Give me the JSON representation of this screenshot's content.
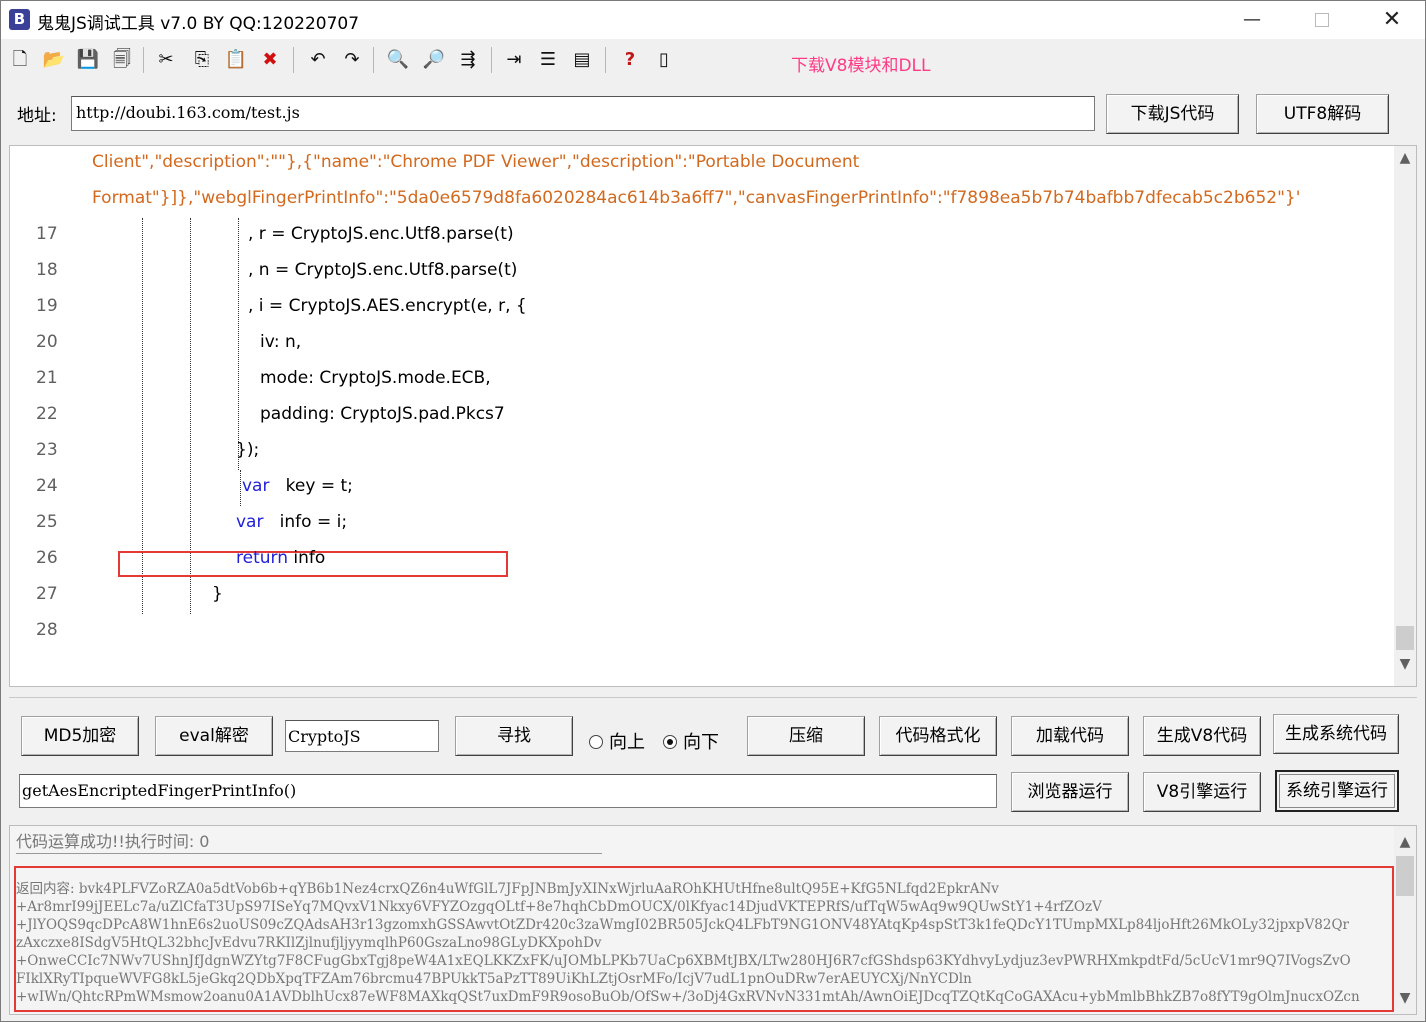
{
  "window": {
    "title": "鬼鬼JS调试工具 v7.0 BY QQ:120220707",
    "app_icon": "B",
    "minimize": "—",
    "close": "✕"
  },
  "toolbar": {
    "icons": [
      {
        "name": "new-file-icon",
        "glyph": "🗋"
      },
      {
        "name": "open-folder-icon",
        "glyph": "📂"
      },
      {
        "name": "save-icon",
        "glyph": "💾"
      },
      {
        "name": "save-all-icon",
        "glyph": "🗐"
      },
      {
        "name": "cut-icon",
        "glyph": "✂"
      },
      {
        "name": "copy-icon",
        "glyph": "⎘"
      },
      {
        "name": "paste-icon",
        "glyph": "📋"
      },
      {
        "name": "delete-icon",
        "glyph": "✖"
      },
      {
        "name": "undo-icon",
        "glyph": "↶"
      },
      {
        "name": "redo-icon",
        "glyph": "↷"
      },
      {
        "name": "find-icon",
        "glyph": "🔍"
      },
      {
        "name": "find-next-icon",
        "glyph": "🔎"
      },
      {
        "name": "replace-icon",
        "glyph": "⇶"
      },
      {
        "name": "indent-icon",
        "glyph": "⇥"
      },
      {
        "name": "numbered-list-icon",
        "glyph": "☰"
      },
      {
        "name": "window-icon",
        "glyph": "▤"
      },
      {
        "name": "help-icon",
        "glyph": "?"
      },
      {
        "name": "panel-icon",
        "glyph": "▯"
      }
    ],
    "download_link": "下载V8模块和DLL"
  },
  "address": {
    "label": "地址:",
    "value": "http://doubi.163.com/test.js",
    "download_button": "下载JS代码",
    "utf8_button": "UTF8解码"
  },
  "editor": {
    "lines": [
      {
        "num": "",
        "parts": [
          {
            "cls": "str",
            "text": "Client\",\"description\":\"\"},{\"name\":\"Chrome PDF Viewer\",\"description\":\"Portable Document"
          }
        ]
      },
      {
        "num": "",
        "parts": [
          {
            "cls": "str",
            "text": "Format\"}]},\"webglFingerPrintInfo\":\"5da0e6579d8fa6020284ac614b3a6ff7\",\"canvasFingerPrintInfo\":\"f7898ea5b7b74bafbb7dfecab5c2b652\"}'"
          }
        ]
      },
      {
        "num": "17",
        "parts": [
          {
            "cls": "txt",
            "text": ", r = CryptoJS.enc.Utf8.parse(t)"
          }
        ]
      },
      {
        "num": "18",
        "parts": [
          {
            "cls": "txt",
            "text": ", n = CryptoJS.enc.Utf8.parse(t)"
          }
        ]
      },
      {
        "num": "19",
        "parts": [
          {
            "cls": "txt",
            "text": ", i = CryptoJS.AES.encrypt(e, r, {"
          }
        ]
      },
      {
        "num": "20",
        "parts": [
          {
            "cls": "txt",
            "text": "iv: n,"
          }
        ]
      },
      {
        "num": "21",
        "parts": [
          {
            "cls": "txt",
            "text": "mode: CryptoJS.mode.ECB,"
          }
        ]
      },
      {
        "num": "22",
        "parts": [
          {
            "cls": "txt",
            "text": "padding: CryptoJS.pad.Pkcs7"
          }
        ]
      },
      {
        "num": "23",
        "parts": [
          {
            "cls": "txt",
            "text": "});"
          }
        ]
      },
      {
        "num": "24",
        "parts": [
          {
            "cls": "kw",
            "text": "var"
          },
          {
            "cls": "txt",
            "text": "   key = t;"
          }
        ]
      },
      {
        "num": "25",
        "parts": [
          {
            "cls": "kw",
            "text": "var"
          },
          {
            "cls": "txt",
            "text": "   info = i;"
          }
        ]
      },
      {
        "num": "26",
        "parts": [
          {
            "cls": "kw",
            "text": "return"
          },
          {
            "cls": "txt",
            "text": " info"
          }
        ]
      },
      {
        "num": "27",
        "parts": [
          {
            "cls": "txt",
            "text": "}"
          }
        ]
      },
      {
        "num": "28",
        "parts": []
      }
    ]
  },
  "controls": {
    "md5_button": "MD5加密",
    "eval_button": "eval解密",
    "search_value": "CryptoJS",
    "find_button": "寻找",
    "radio_up": "向上",
    "radio_down": "向下",
    "radio_selected": "down",
    "compress_button": "压缩",
    "format_button": "代码格式化",
    "load_button": "加载代码",
    "gen_v8_button": "生成V8代码",
    "gen_system_button": "生成系统代码",
    "function_value": "getAesEncriptedFingerPrintInfo()",
    "browser_run_button": "浏览器运行",
    "v8_run_button": "V8引擎运行",
    "system_run_button": "系统引擎运行"
  },
  "output": {
    "status": "代码运算成功!!执行时间: 0",
    "result_lines": [
      "返回内容: bvk4PLFVZoRZA0a5dtVob6b+qYB6b1Nez4crxQZ6n4uWfGlL7JFpJNBmJyXINxWjrluAaROhKHUtHfne8ultQ95E+KfG5NLfqd2EpkrANv",
      "+Ar8mrI99jJEELc7a/uZlCfaT3UpS97ISeYq7MQvxV1Nkxy6VFYZOzgqOLtf+8e7hqhCbDmOUCX/0lKfyac14DjudVKTEPRfS/ufTqW5wAq9w9QUwStY1+4rfZOzV",
      "+JlYOQS9qcDPcA8W1hnE6s2uoUS09cZQAdsAH3r13gzomxhGSSAwvtOtZDr420c3zaWmgI02BR505JckQ4LFbT9NG1ONV48YAtqKp4spStT3k1feQDcY1TUmpMXLp84ljoHft26MkOLy32jpxpV82Qr",
      "zAxczxe8ISdgV5HtQL32bhcJvEdvu7RKIlZjlnufjljyymqlhP60GszaLno98GLyDKXpohDv",
      "+OnweCCIc7NWv7UShnJfJdgnWZYtg7F8CFugGbxTgj8peW4A1xEQLKKZxFK/uJOMbLPKb7UaCp6XBMtJBX/LTw280HJ6R7cfGShdsp63KYdhvyLydjuz3evPWRHXmkpdtFd/5cUcV1mr9Q7IVogsZvO",
      "FIklXRyTIpqueWVFG8kL5jeGkq2QDbXpqTFZAm76brcmu47BPUkkT5aPzTT89UiKhLZtjOsrMFo/IcjV7udL1pnOuDRw7erAEUYCXj/NnYCDln",
      "+wIWn/QhtcRPmWMsmow2oanu0A1AVDblhUcx87eWF8MAXkqQSt7uxDmF9R9osoBuOb/OfSw+/3oDj4GxRVNvN331mtAh/AwnOiEJDcqTZQtKqCoGAXAcu+ybMmlbBhkZB7o8fYT9gOlmJnucxOZcn"
    ]
  }
}
